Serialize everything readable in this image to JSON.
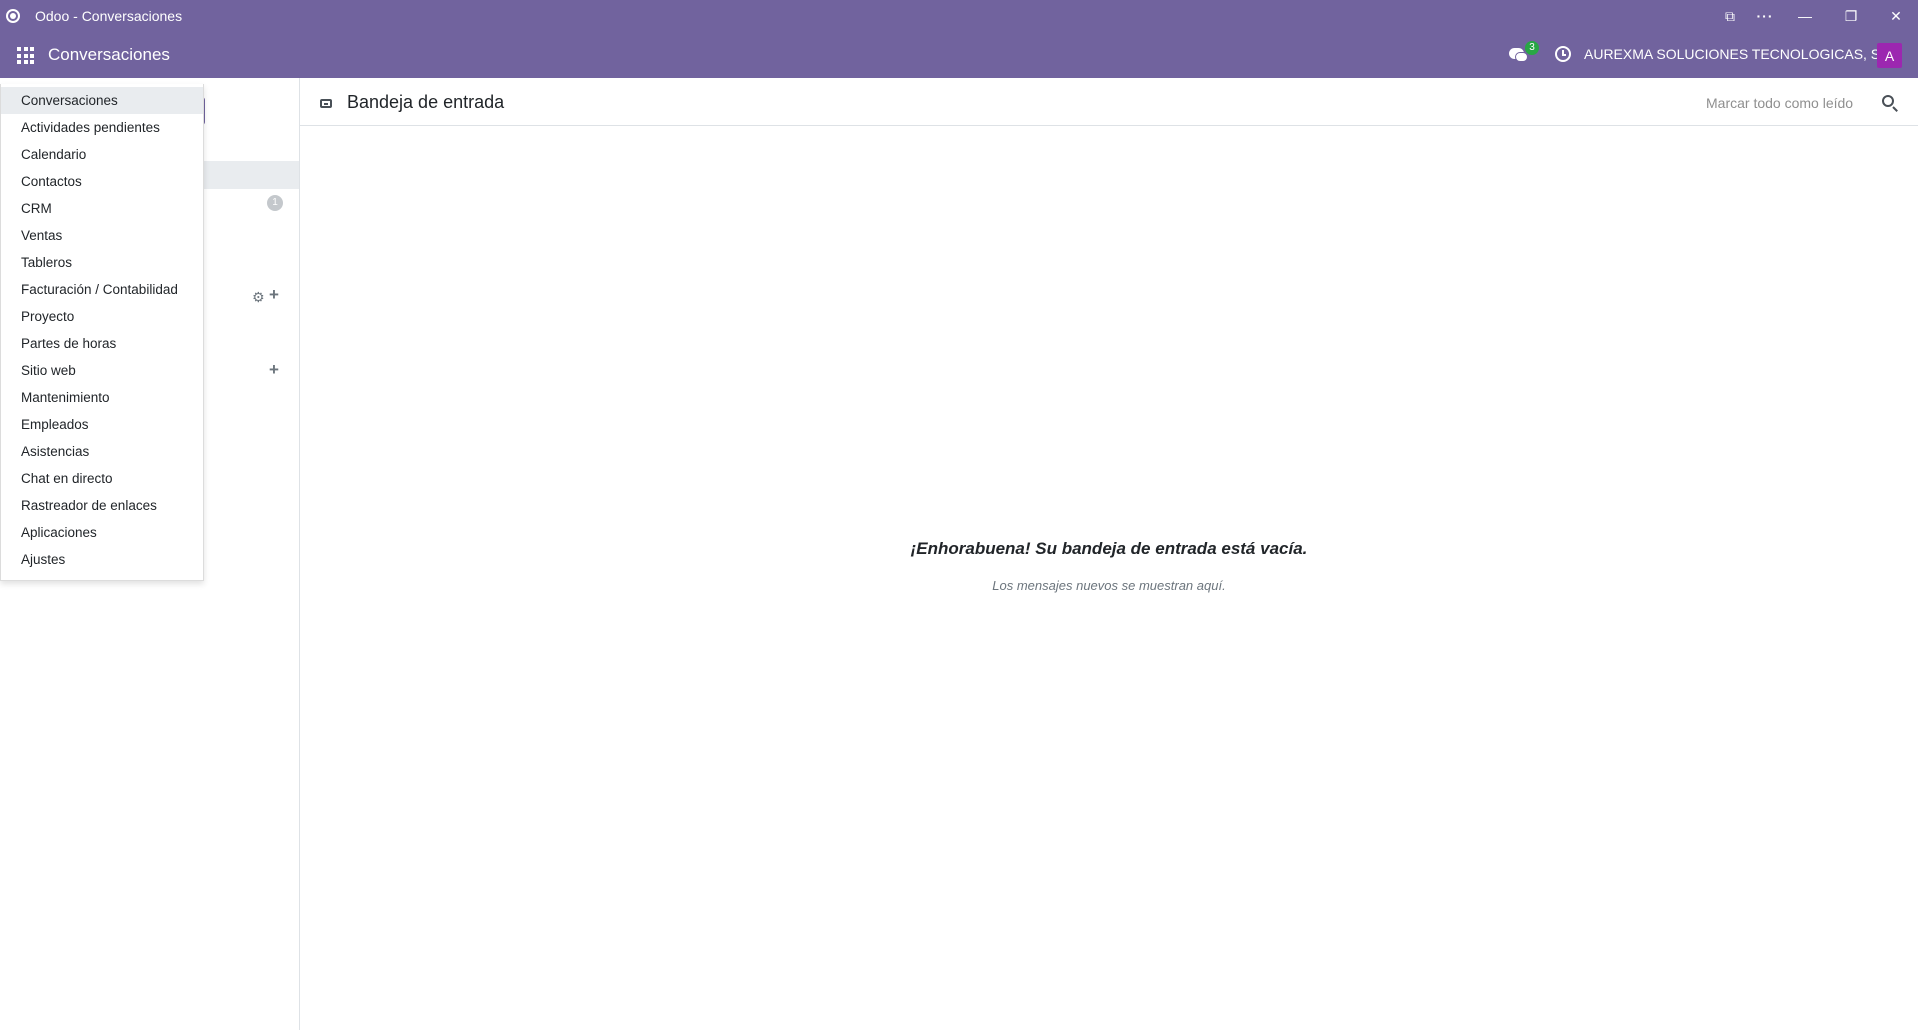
{
  "window": {
    "title": "Odoo - Conversaciones"
  },
  "navbar": {
    "app_name": "Conversaciones",
    "chat_badge": "3",
    "company": "AUREXMA SOLUCIONES TECNOLOGICAS, S.L.",
    "avatar_initial": "A",
    "colors": {
      "brand": "#71639e",
      "avatar": "#9c27b0",
      "badge": "#28a745"
    }
  },
  "app_menu": {
    "items": [
      "Conversaciones",
      "Actividades pendientes",
      "Calendario",
      "Contactos",
      "CRM",
      "Ventas",
      "Tableros",
      "Facturación / Contabilidad",
      "Proyecto",
      "Partes de horas",
      "Sitio web",
      "Mantenimiento",
      "Empleados",
      "Asistencias",
      "Chat en directo",
      "Rastreador de enlaces",
      "Aplicaciones",
      "Ajustes"
    ]
  },
  "sidebar": {
    "count_badge": "1"
  },
  "main": {
    "title": "Bandeja de entrada",
    "mark_all_read": "Marcar todo como leído",
    "empty_title": "¡Enhorabuena! Su bandeja de entrada está vacía.",
    "empty_subtitle": "Los mensajes nuevos se muestran aquí."
  }
}
